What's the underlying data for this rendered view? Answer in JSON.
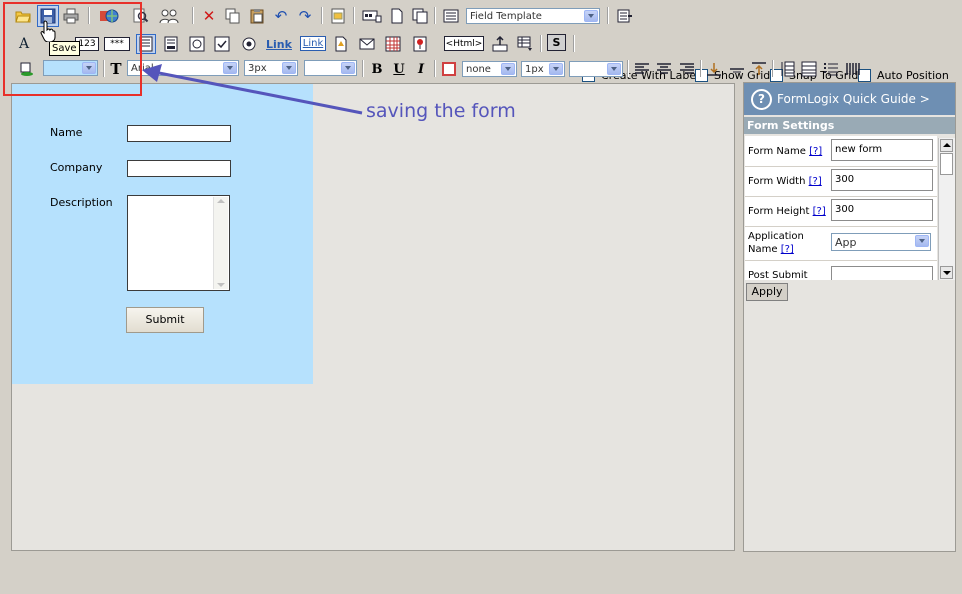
{
  "toolbar": {
    "row1": {
      "field_template": "Field Template",
      "save_tooltip": "Save"
    },
    "row2": {
      "text_label": "A",
      "number_label": "123",
      "password_label": "***",
      "link1": "Link",
      "link2": "Link",
      "html_label": "<Html>",
      "s_label": "S",
      "create_with_label": "Create With Label",
      "show_grid": "Show Grid",
      "snap_to_grid": "Snap To Grid",
      "auto_position": "Auto Position"
    },
    "row3": {
      "font_value": "Arial",
      "size_value": "3px",
      "bold": "B",
      "underline": "U",
      "italic": "I",
      "border_style": "none",
      "border_width": "1px",
      "text_icon": "T"
    }
  },
  "annotation": {
    "text": "saving the form",
    "color": "#5555bb",
    "highlight_color": "#e8302a"
  },
  "form": {
    "name_label": "Name",
    "company_label": "Company",
    "description_label": "Description",
    "submit_label": "Submit",
    "background": "#b6e1fd"
  },
  "side_panel": {
    "guide_title": "FormLogix Quick Guide >",
    "guide_icon": "?",
    "settings_title": "Form Settings",
    "help_marker": "[?]",
    "rows": [
      {
        "label": "Form Name",
        "value": "new form"
      },
      {
        "label": "Form Width",
        "value": "300"
      },
      {
        "label": "Form Height",
        "value": "300"
      },
      {
        "label_line1": "Application",
        "label_line2": "Name",
        "value": "App"
      },
      {
        "label": "Post Submit",
        "value": ""
      }
    ],
    "apply_label": "Apply"
  }
}
